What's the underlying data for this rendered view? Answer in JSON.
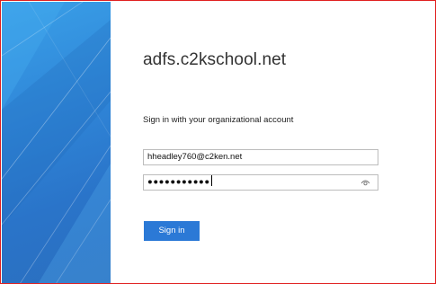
{
  "login": {
    "title": "adfs.c2kschool.net",
    "subtitle": "Sign in with your organizational account",
    "username_value": "hheadley760@c2ken.net",
    "password_masked": "●●●●●●●●●●●",
    "sign_in_label": "Sign in"
  },
  "icons": {
    "reveal": "eye-icon"
  },
  "colors": {
    "frame_border": "#e02020",
    "illustration": "#2f86d8",
    "button": "#2b79d6"
  }
}
